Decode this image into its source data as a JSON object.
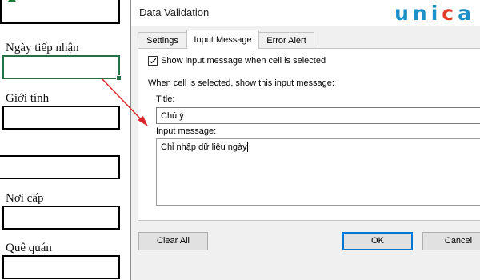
{
  "sheet": {
    "fields": [
      {
        "label": "Ngày tiếp nhận"
      },
      {
        "label": "Giới tính"
      },
      {
        "label": ""
      },
      {
        "label": "Nơi cấp"
      },
      {
        "label": "Quê quán"
      }
    ]
  },
  "dialog": {
    "title": "Data Validation",
    "tabs": [
      "Settings",
      "Input Message",
      "Error Alert"
    ],
    "active_tab": "Input Message",
    "show_message_label": "Show input message when cell is selected",
    "show_message_checked": true,
    "section_text": "When cell is selected, show this input message:",
    "title_label": "Title:",
    "title_value": "Chú ý",
    "message_label": "Input message:",
    "message_value": "Chỉ nhập dữ liệu ngày",
    "buttons": {
      "clear_all": "Clear All",
      "ok": "OK",
      "cancel": "Cancel"
    }
  },
  "brand": {
    "logo_text": "unica",
    "colors": {
      "blue": "#1e90c8",
      "red": "#e2402c"
    }
  },
  "colors": {
    "selection": "#217346",
    "arrow": "#d9262a",
    "focus": "#0078d7"
  }
}
